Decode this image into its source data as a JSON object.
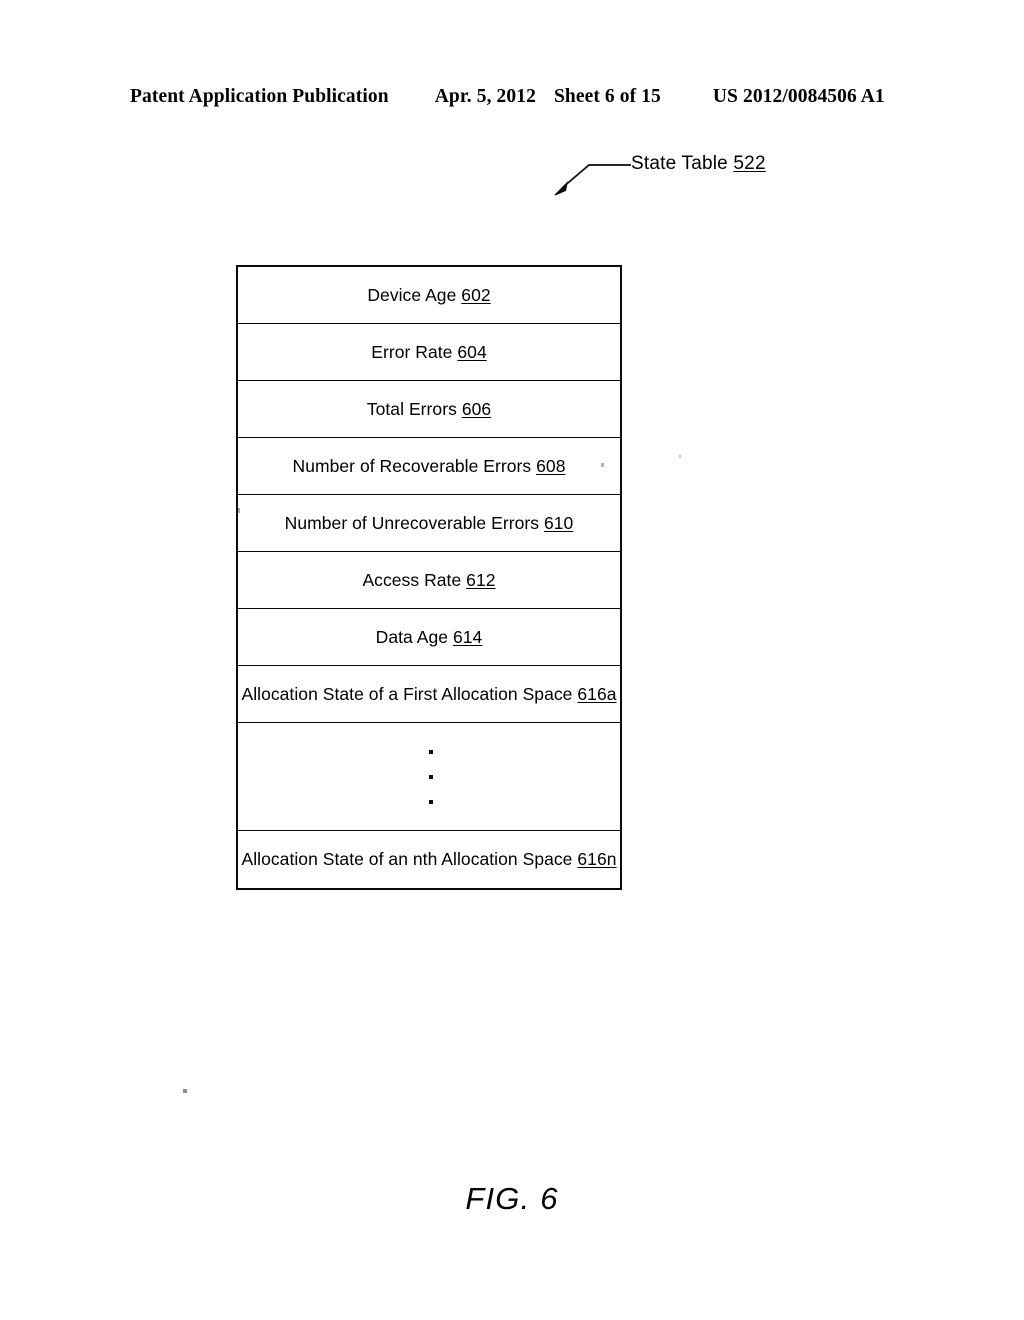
{
  "header": {
    "publication": "Patent Application Publication",
    "date": "Apr. 5, 2012",
    "sheet": "Sheet 6 of 15",
    "document_number": "US 2012/0084506 A1"
  },
  "callout": {
    "label": "State Table",
    "ref": "522",
    "leader_icon": "arrow-leader-line"
  },
  "state_table": {
    "rows": [
      {
        "label": "Device Age",
        "ref": "602",
        "type": "field"
      },
      {
        "label": "Error Rate",
        "ref": "604",
        "type": "field"
      },
      {
        "label": "Total Errors",
        "ref": "606",
        "type": "field"
      },
      {
        "label": "Number of Recoverable Errors",
        "ref": "608",
        "type": "field"
      },
      {
        "label": "Number of Unrecoverable Errors",
        "ref": "610",
        "type": "field"
      },
      {
        "label": "Access Rate",
        "ref": "612",
        "type": "field"
      },
      {
        "label": "Data Age",
        "ref": "614",
        "type": "field"
      },
      {
        "label": "Allocation State of a First Allocation Space",
        "ref": "616a",
        "type": "field"
      },
      {
        "label": "",
        "ref": "",
        "type": "ellipsis"
      },
      {
        "label": "Allocation State of an nth Allocation Space",
        "ref": "616n",
        "type": "field"
      }
    ]
  },
  "figure": {
    "caption": "FIG. 6"
  }
}
